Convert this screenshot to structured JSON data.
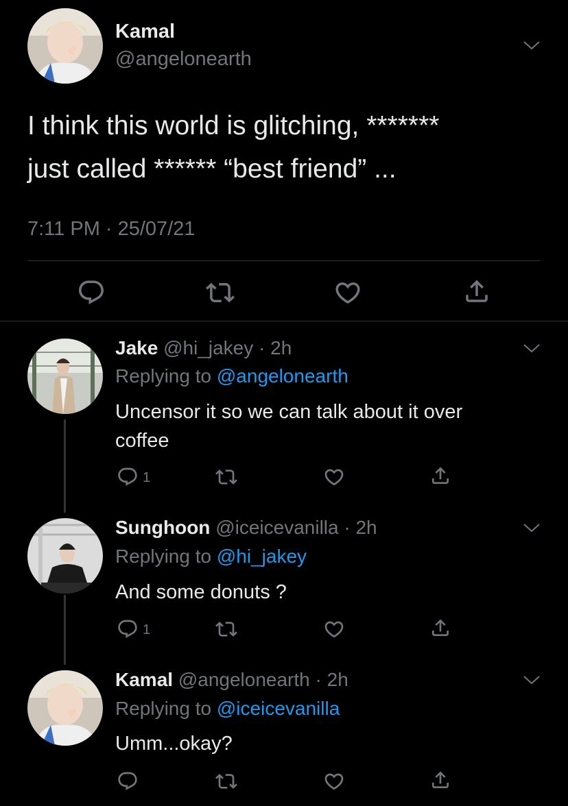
{
  "main_tweet": {
    "author_name": "Kamal",
    "author_handle": "@angelonearth",
    "text_line1": "I think this world is glitching, *******",
    "text_line2": "just called ****** “best friend” ...",
    "timestamp": "7:11 PM · 25/07/21"
  },
  "replies": [
    {
      "name": "Jake",
      "handle": "@hi_jakey",
      "time": "· 2h",
      "replying_label": "Replying to",
      "replying_to": "@angelonearth",
      "text_line1": "Uncensor it so we can talk about it over",
      "text_line2": "coffee",
      "reply_count": "1"
    },
    {
      "name": "Sunghoon",
      "handle": "@iceicevanilla",
      "time": "· 2h",
      "replying_label": "Replying to",
      "replying_to": "@hi_jakey",
      "text_line1": "And some donuts ?",
      "reply_count": "1"
    },
    {
      "name": "Kamal",
      "handle": "@angelonearth",
      "time": "· 2h",
      "replying_label": "Replying to",
      "replying_to": "@iceicevanilla",
      "text_line1": "Umm...okay?"
    }
  ],
  "icons": {
    "reply": "reply-icon",
    "retweet": "retweet-icon",
    "like": "heart-icon",
    "share": "share-icon",
    "more": "chevron-down-icon"
  },
  "colors": {
    "background": "#000000",
    "text": "#e7e9ea",
    "muted": "#71767b",
    "link": "#1d9bf0"
  }
}
